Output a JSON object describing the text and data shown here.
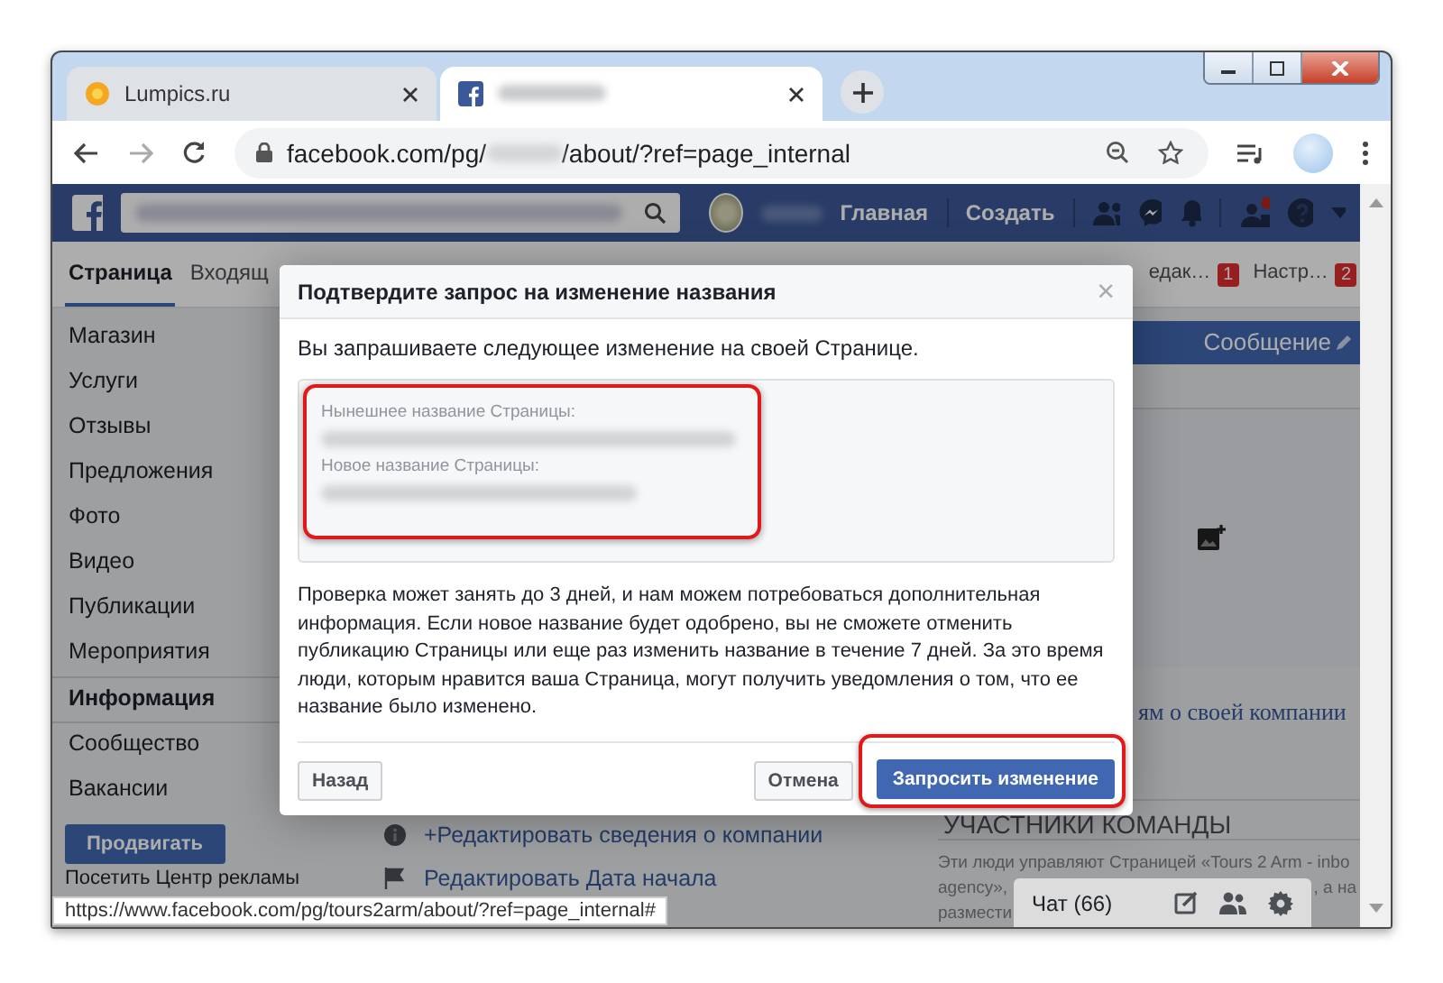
{
  "browser": {
    "tabs": [
      {
        "title": "Lumpics.ru",
        "selected": false
      },
      {
        "selected": true
      }
    ],
    "url_start": "facebook.com/pg/",
    "url_end": "/about/?ref=page_internal",
    "status_url": "https://www.facebook.com/pg/tours2arm/about/?ref=page_internal#"
  },
  "header": {
    "nav": [
      "Главная",
      "Создать"
    ]
  },
  "page_tabs": [
    {
      "label": "Страница",
      "selected": true
    },
    {
      "label": "Входящ",
      "selected": false
    },
    {
      "label": "едак…",
      "badge": "1",
      "selected": false
    },
    {
      "label": "Настр…",
      "badge": "2",
      "selected": false
    }
  ],
  "sidebar": {
    "items": [
      {
        "label": "Магазин",
        "selected": false
      },
      {
        "label": "Услуги",
        "selected": false
      },
      {
        "label": "Отзывы",
        "selected": false
      },
      {
        "label": "Предложения",
        "selected": false
      },
      {
        "label": "Фото",
        "selected": false
      },
      {
        "label": "Видео",
        "selected": false
      },
      {
        "label": "Публикации",
        "selected": false
      },
      {
        "label": "Мероприятия",
        "selected": false
      },
      {
        "label": "Информация",
        "selected": true
      },
      {
        "label": "Сообщество",
        "selected": false
      },
      {
        "label": "Вакансии",
        "selected": false
      }
    ],
    "promote": "Продвигать",
    "ad_center": "Посетить Центр рекламы"
  },
  "main": {
    "message_button": "Сообщение",
    "about_link": "ям о своей компании",
    "team_heading": "УЧАСТНИКИ КОМАНДЫ",
    "team_text": [
      "Эти люди управляют Страницей «Tours 2 Arm - inbo",
      "agency», ",
      "размести"
    ],
    "team_text_right": ", а на",
    "edit_links": [
      "+Редактировать сведения о компании",
      "Редактировать Дата начала"
    ]
  },
  "chat": {
    "label": "Чат (66)"
  },
  "dialog": {
    "title": "Подтвердите запрос на изменение названия",
    "intro": "Вы запрашиваете следующее изменение на своей Странице.",
    "current_label": "Нынешнее название Страницы:",
    "new_label": "Новое название Страницы:",
    "notice": "Проверка может занять до 3 дней, и нам можем потребоваться дополнительная информация. Если новое название будет одобрено, вы не сможете отменить публикацию Страницы или еще раз изменить название в течение 7 дней. За это время люди, которым нравится ваша Страница, могут получить уведомления о том, что ее название было изменено.",
    "close": "×",
    "back": "Назад",
    "cancel": "Отмена",
    "submit": "Запросить изменение"
  }
}
